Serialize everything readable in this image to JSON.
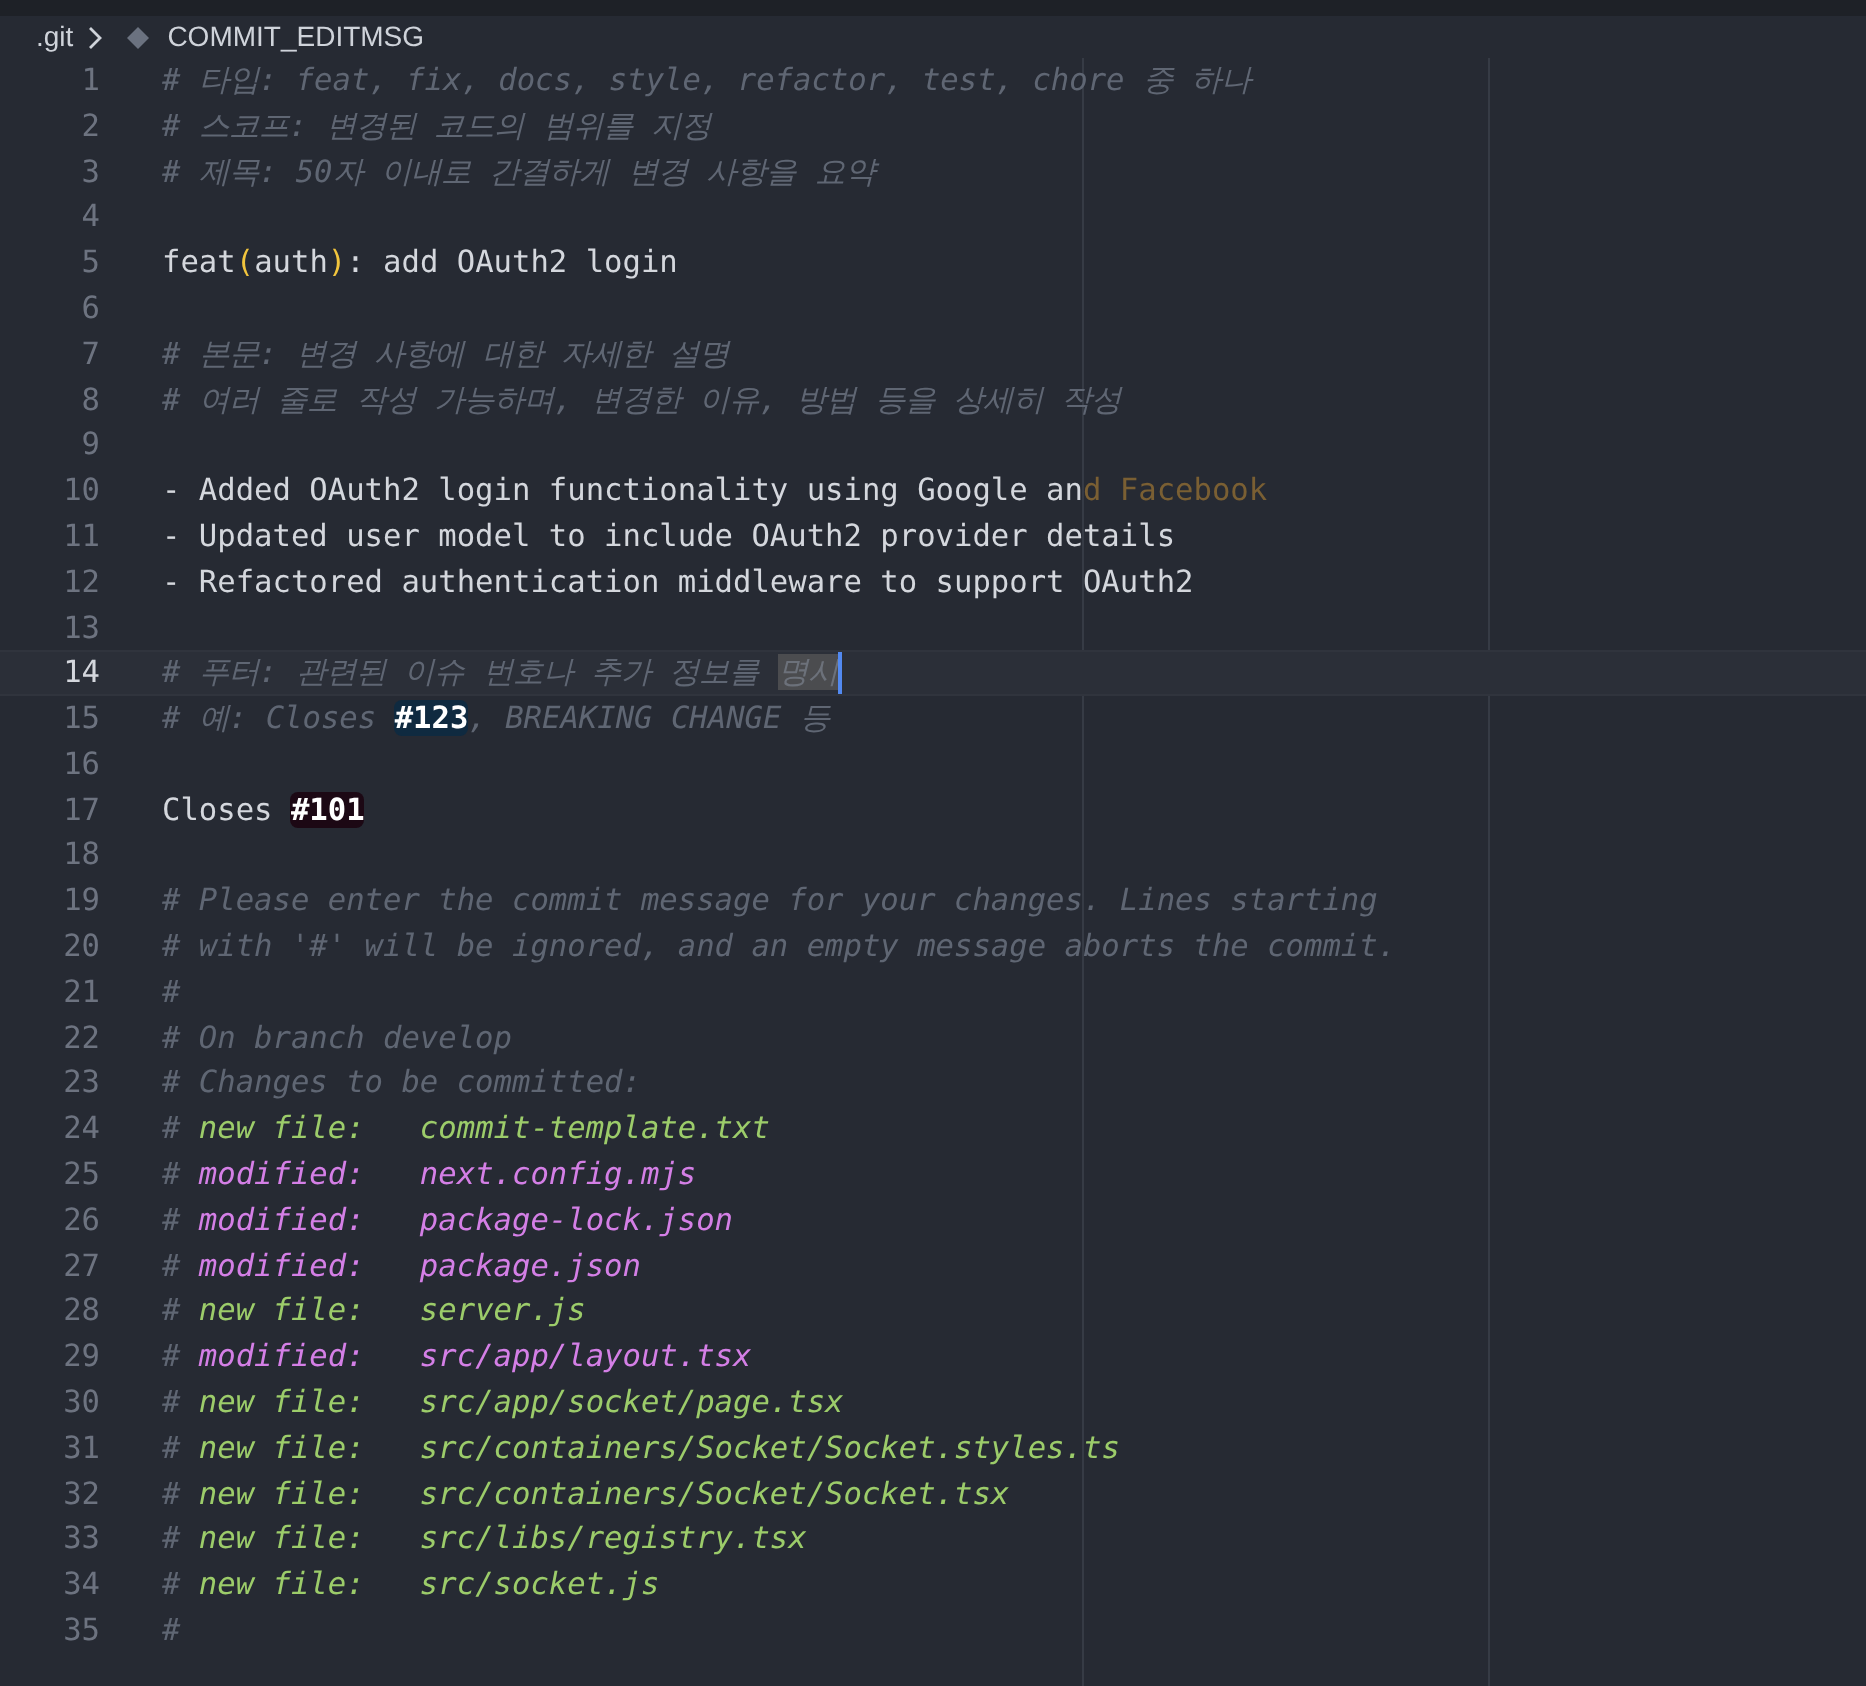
{
  "breadcrumb": {
    "folder": ".git",
    "file": "COMMIT_EDITMSG"
  },
  "lines": [
    {
      "number": "1",
      "current": false,
      "segments": [
        {
          "kind": "comment",
          "text": "# 타입: feat, fix, docs, style, refactor, test, chore 중 하나"
        }
      ]
    },
    {
      "number": "2",
      "current": false,
      "segments": [
        {
          "kind": "comment",
          "text": "# 스코프: 변경된 코드의 범위를 지정"
        }
      ]
    },
    {
      "number": "3",
      "current": false,
      "segments": [
        {
          "kind": "comment",
          "text": "# 제목: 50자 이내로 간결하게 변경 사항을 요약"
        }
      ]
    },
    {
      "number": "4",
      "current": false
    },
    {
      "number": "5",
      "current": false,
      "segments": [
        {
          "kind": "plain",
          "text": "feat"
        },
        {
          "kind": "paren",
          "text": "("
        },
        {
          "kind": "plain",
          "text": "auth"
        },
        {
          "kind": "paren",
          "text": ")"
        },
        {
          "kind": "plain",
          "text": ": add OAuth2 login"
        }
      ]
    },
    {
      "number": "6",
      "current": false
    },
    {
      "number": "7",
      "current": false,
      "segments": [
        {
          "kind": "comment",
          "text": "# 본문: 변경 사항에 대한 자세한 설명"
        }
      ]
    },
    {
      "number": "8",
      "current": false,
      "segments": [
        {
          "kind": "comment",
          "text": "# 여러 줄로 작성 가능하며, 변경한 이유, 방법 등을 상세히 작성"
        }
      ]
    },
    {
      "number": "9",
      "current": false
    },
    {
      "number": "10",
      "current": false,
      "segments": [
        {
          "kind": "plain",
          "text": "- Added OAuth2 login functionality using Google an"
        },
        {
          "kind": "overflow",
          "text": "d Facebook"
        }
      ]
    },
    {
      "number": "11",
      "current": false,
      "segments": [
        {
          "kind": "plain",
          "text": "- Updated user model to include OAuth2 provider details"
        }
      ]
    },
    {
      "number": "12",
      "current": false,
      "segments": [
        {
          "kind": "plain",
          "text": "- Refactored authentication middleware to support OAuth2"
        }
      ]
    },
    {
      "number": "13",
      "current": false
    },
    {
      "number": "14",
      "current": true,
      "segments": [
        {
          "kind": "comment",
          "text": "# 푸터: 관련된 이슈 번호나 추가 정보를 "
        },
        {
          "kind": "selected",
          "text": "명시"
        }
      ]
    },
    {
      "number": "15",
      "current": false,
      "segments": [
        {
          "kind": "comment",
          "text": "# 예: Closes "
        },
        {
          "kind": "issue",
          "text": "#123",
          "color": "#0f2a40"
        },
        {
          "kind": "comment",
          "text": ", BREAKING CHANGE 등"
        }
      ]
    },
    {
      "number": "16",
      "current": false
    },
    {
      "number": "17",
      "current": false,
      "segments": [
        {
          "kind": "plain",
          "text": "Closes "
        },
        {
          "kind": "issue",
          "text": "#101",
          "color": "#1c0814"
        }
      ]
    },
    {
      "number": "18",
      "current": false
    },
    {
      "number": "19",
      "current": false,
      "segments": [
        {
          "kind": "comment",
          "text": "# Please enter the commit message for your changes. Lines starting"
        }
      ]
    },
    {
      "number": "20",
      "current": false,
      "segments": [
        {
          "kind": "comment",
          "text": "# with '#' will be ignored, and an empty message aborts the commit."
        }
      ]
    },
    {
      "number": "21",
      "current": false,
      "segments": [
        {
          "kind": "comment",
          "text": "#"
        }
      ]
    },
    {
      "number": "22",
      "current": false,
      "segments": [
        {
          "kind": "comment",
          "text": "# On branch develop"
        }
      ]
    },
    {
      "number": "23",
      "current": false,
      "segments": [
        {
          "kind": "comment",
          "text": "# Changes to be committed:"
        }
      ]
    },
    {
      "number": "24",
      "current": false,
      "segments": [
        {
          "kind": "comment",
          "text": "# "
        },
        {
          "kind": "new",
          "text": "new file:   commit-template.txt"
        }
      ]
    },
    {
      "number": "25",
      "current": false,
      "segments": [
        {
          "kind": "comment",
          "text": "# "
        },
        {
          "kind": "modified",
          "text": "modified:   next.config.mjs"
        }
      ]
    },
    {
      "number": "26",
      "current": false,
      "segments": [
        {
          "kind": "comment",
          "text": "# "
        },
        {
          "kind": "modified",
          "text": "modified:   package-lock.json"
        }
      ]
    },
    {
      "number": "27",
      "current": false,
      "segments": [
        {
          "kind": "comment",
          "text": "# "
        },
        {
          "kind": "modified",
          "text": "modified:   package.json"
        }
      ]
    },
    {
      "number": "28",
      "current": false,
      "segments": [
        {
          "kind": "comment",
          "text": "# "
        },
        {
          "kind": "new",
          "text": "new file:   server.js"
        }
      ]
    },
    {
      "number": "29",
      "current": false,
      "segments": [
        {
          "kind": "comment",
          "text": "# "
        },
        {
          "kind": "modified",
          "text": "modified:   src/app/layout.tsx"
        }
      ]
    },
    {
      "number": "30",
      "current": false,
      "segments": [
        {
          "kind": "comment",
          "text": "# "
        },
        {
          "kind": "new",
          "text": "new file:   src/app/socket/page.tsx"
        }
      ]
    },
    {
      "number": "31",
      "current": false,
      "segments": [
        {
          "kind": "comment",
          "text": "# "
        },
        {
          "kind": "new",
          "text": "new file:   src/containers/Socket/Socket.styles.ts"
        }
      ]
    },
    {
      "number": "32",
      "current": false,
      "segments": [
        {
          "kind": "comment",
          "text": "# "
        },
        {
          "kind": "new",
          "text": "new file:   src/containers/Socket/Socket.tsx"
        }
      ]
    },
    {
      "number": "33",
      "current": false,
      "segments": [
        {
          "kind": "comment",
          "text": "# "
        },
        {
          "kind": "new",
          "text": "new file:   src/libs/registry.tsx"
        }
      ]
    },
    {
      "number": "34",
      "current": false,
      "segments": [
        {
          "kind": "comment",
          "text": "# "
        },
        {
          "kind": "new",
          "text": "new file:   src/socket.js"
        }
      ]
    },
    {
      "number": "35",
      "current": false,
      "segments": [
        {
          "kind": "comment",
          "text": "#"
        }
      ]
    }
  ]
}
